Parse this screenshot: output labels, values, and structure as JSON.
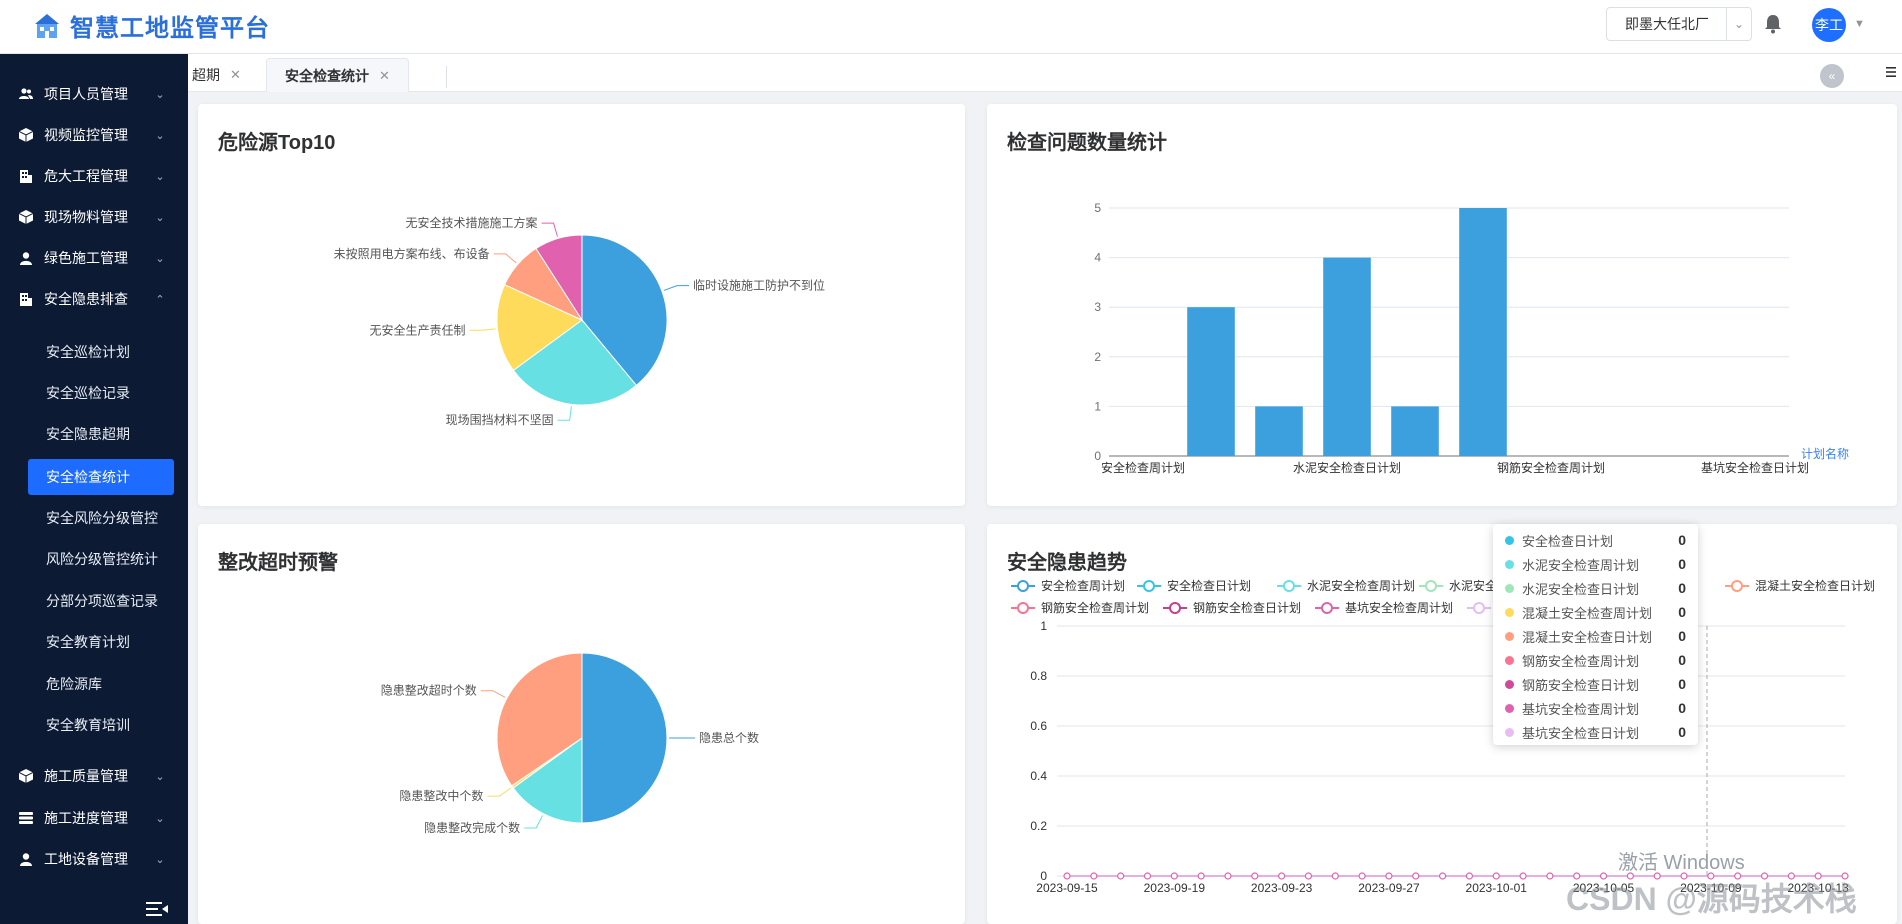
{
  "app": {
    "title": "智慧工地监管平台",
    "org_selected": "即墨大任北厂",
    "user_name": "李工"
  },
  "sidebar": {
    "items": [
      {
        "label": "项目人员管理",
        "icon": "people-icon"
      },
      {
        "label": "视频监控管理",
        "icon": "cube-icon"
      },
      {
        "label": "危大工程管理",
        "icon": "building-icon"
      },
      {
        "label": "现场物料管理",
        "icon": "cube-icon"
      },
      {
        "label": "绿色施工管理",
        "icon": "person-icon"
      },
      {
        "label": "安全隐患排查",
        "icon": "building-icon",
        "expanded": true
      }
    ],
    "sub_items": [
      {
        "label": "安全巡检计划"
      },
      {
        "label": "安全巡检记录"
      },
      {
        "label": "安全隐患超期"
      },
      {
        "label": "安全检查统计",
        "active": true
      },
      {
        "label": "安全风险分级管控"
      },
      {
        "label": "风险分级管控统计"
      },
      {
        "label": "分部分项巡查记录"
      },
      {
        "label": "安全教育计划"
      },
      {
        "label": "危险源库"
      },
      {
        "label": "安全教育培训"
      }
    ],
    "items_bottom": [
      {
        "label": "施工质量管理",
        "icon": "cube-icon"
      },
      {
        "label": "施工进度管理",
        "icon": "list-icon"
      },
      {
        "label": "工地设备管理",
        "icon": "person-icon"
      }
    ]
  },
  "tabs": [
    {
      "label": "超期",
      "active": false
    },
    {
      "label": "安全检查统计",
      "active": true
    }
  ],
  "cards": {
    "hazard_top10": {
      "title": "危险源Top10"
    },
    "issue_count": {
      "title": "检查问题数量统计"
    },
    "overdue_warning": {
      "title": "整改超时预警"
    },
    "trend": {
      "title": "安全隐患趋势"
    }
  },
  "colors": {
    "sidebar_bg": "#0c1a33",
    "active_blue": "#1d6bff",
    "bar_blue": "#3ba0dd"
  },
  "chart_data": [
    {
      "type": "pie",
      "title": "危险源Top10",
      "slices": [
        {
          "label": "临时设施施工防护不到位",
          "value": 3,
          "color": "#3ba0dd"
        },
        {
          "label": "现场围挡材料不坚固",
          "value": 2,
          "color": "#67e0e3"
        },
        {
          "label": "无安全生产责任制",
          "value": 1.3,
          "color": "#ffdb5c"
        },
        {
          "label": "未按照用电方案布线、布设备",
          "value": 0.7,
          "color": "#ff9f7f"
        },
        {
          "label": "无安全技术措施施工方案",
          "value": 0.7,
          "color": "#e062ae"
        }
      ]
    },
    {
      "type": "bar",
      "title": "检查问题数量统计",
      "categories": [
        "安全检查周计划",
        "安全检查日计划",
        "水泥安全检查周计划",
        "水泥安全检查日计划",
        "混凝土安全检查周计划",
        "混凝土安全检查日计划",
        "钢筋安全检查周计划",
        "钢筋安全检查日计划",
        "基坑安全检查周计划",
        "基坑安全检查日计划"
      ],
      "tick_labels": [
        "安全检查周计划",
        "水泥安全检查日计划",
        "钢筋安全检查周计划",
        "基坑安全检查日计划"
      ],
      "values": [
        0,
        3,
        1,
        4,
        1,
        5,
        0,
        0,
        0,
        0
      ],
      "xlabel": "计划名称",
      "ylim": [
        0,
        5
      ],
      "yticks": [
        0,
        1,
        2,
        3,
        4,
        5
      ]
    },
    {
      "type": "pie",
      "title": "整改超时预警",
      "slices": [
        {
          "label": "隐患总个数",
          "value": 5,
          "color": "#3ba0dd"
        },
        {
          "label": "隐患整改完成个数",
          "value": 1.5,
          "color": "#67e0e3"
        },
        {
          "label": "隐患整改中个数",
          "value": 0.05,
          "color": "#ffdb5c"
        },
        {
          "label": "隐患整改超时个数",
          "value": 3.45,
          "color": "#ff9f7f"
        }
      ]
    },
    {
      "type": "line",
      "title": "安全隐患趋势",
      "x": [
        "2023-09-15",
        "2023-09-16",
        "2023-09-17",
        "2023-09-18",
        "2023-09-19",
        "2023-09-20",
        "2023-09-21",
        "2023-09-22",
        "2023-09-23",
        "2023-09-24",
        "2023-09-25",
        "2023-09-26",
        "2023-09-27",
        "2023-09-28",
        "2023-09-29",
        "2023-09-30",
        "2023-10-01",
        "2023-10-02",
        "2023-10-03",
        "2023-10-04",
        "2023-10-05",
        "2023-10-06",
        "2023-10-07",
        "2023-10-08",
        "2023-10-09",
        "2023-10-10",
        "2023-10-11",
        "2023-10-12",
        "2023-10-13",
        "2023-10-14"
      ],
      "xtick_labels": [
        "2023-09-15",
        "2023-09-19",
        "2023-09-23",
        "2023-09-27",
        "2023-10-01",
        "2023-10-05",
        "2023-10-09",
        "2023-10-13"
      ],
      "ylim": [
        0,
        1
      ],
      "yticks": [
        "0",
        "0.2",
        "0.4",
        "0.6",
        "0.8",
        "1"
      ],
      "series": [
        {
          "name": "安全检查周计划",
          "color": "#3ba0dd",
          "value": 0
        },
        {
          "name": "安全检查日计划",
          "color": "#32c5e9",
          "value": 0
        },
        {
          "name": "水泥安全检查周计划",
          "color": "#67e0e3",
          "value": 0
        },
        {
          "name": "水泥安全检查日计划",
          "color": "#9fe6b8",
          "value": 0
        },
        {
          "name": "混凝土安全检查周计划",
          "color": "#ffdb5c",
          "value": 0
        },
        {
          "name": "混凝土安全检查日计划",
          "color": "#ff9f7f",
          "value": 0
        },
        {
          "name": "钢筋安全检查周计划",
          "color": "#fb7293",
          "value": 0
        },
        {
          "name": "钢筋安全检查日计划",
          "color": "#e7bcf3",
          "value": 0,
          "dark": "#d14a9a"
        },
        {
          "name": "基坑安全检查周计划",
          "color": "#e062ae",
          "value": 0
        },
        {
          "name": "基坑安全检查日计划",
          "color": "#e7bcf3",
          "value": 0
        }
      ],
      "legend_visible": [
        {
          "name": "安全检查周计划",
          "color": "#3ba0dd"
        },
        {
          "name": "安全检查日计划",
          "color": "#32c5e9"
        },
        {
          "name": "水泥安全检查周计划",
          "color": "#67e0e3"
        },
        {
          "name": "水泥安全",
          "color": "#9fe6b8"
        },
        {
          "name": "混凝土安全检查日计划",
          "color": "#ff9f7f"
        },
        {
          "name": "钢筋安全检查周计划",
          "color": "#fb7293"
        },
        {
          "name": "钢筋安全检查日计划",
          "color": "#c93d8e"
        },
        {
          "name": "基坑安全检查周计划",
          "color": "#e062ae"
        }
      ],
      "tooltip_rows": [
        {
          "name": "安全检查日计划",
          "color": "#32c5e9",
          "value": "0"
        },
        {
          "name": "水泥安全检查周计划",
          "color": "#67e0e3",
          "value": "0"
        },
        {
          "name": "水泥安全检查日计划",
          "color": "#9fe6b8",
          "value": "0"
        },
        {
          "name": "混凝土安全检查周计划",
          "color": "#ffdb5c",
          "value": "0"
        },
        {
          "name": "混凝土安全检查日计划",
          "color": "#ff9f7f",
          "value": "0"
        },
        {
          "name": "钢筋安全检查周计划",
          "color": "#fb7293",
          "value": "0"
        },
        {
          "name": "钢筋安全检查日计划",
          "color": "#d14a9a",
          "value": "0"
        },
        {
          "name": "基坑安全检查周计划",
          "color": "#e062ae",
          "value": "0"
        },
        {
          "name": "基坑安全检查日计划",
          "color": "#e7bcf3",
          "value": "0"
        }
      ]
    }
  ],
  "watermark": {
    "activate": "激活 Windows",
    "credit": "CSDN @源码技术栈"
  }
}
